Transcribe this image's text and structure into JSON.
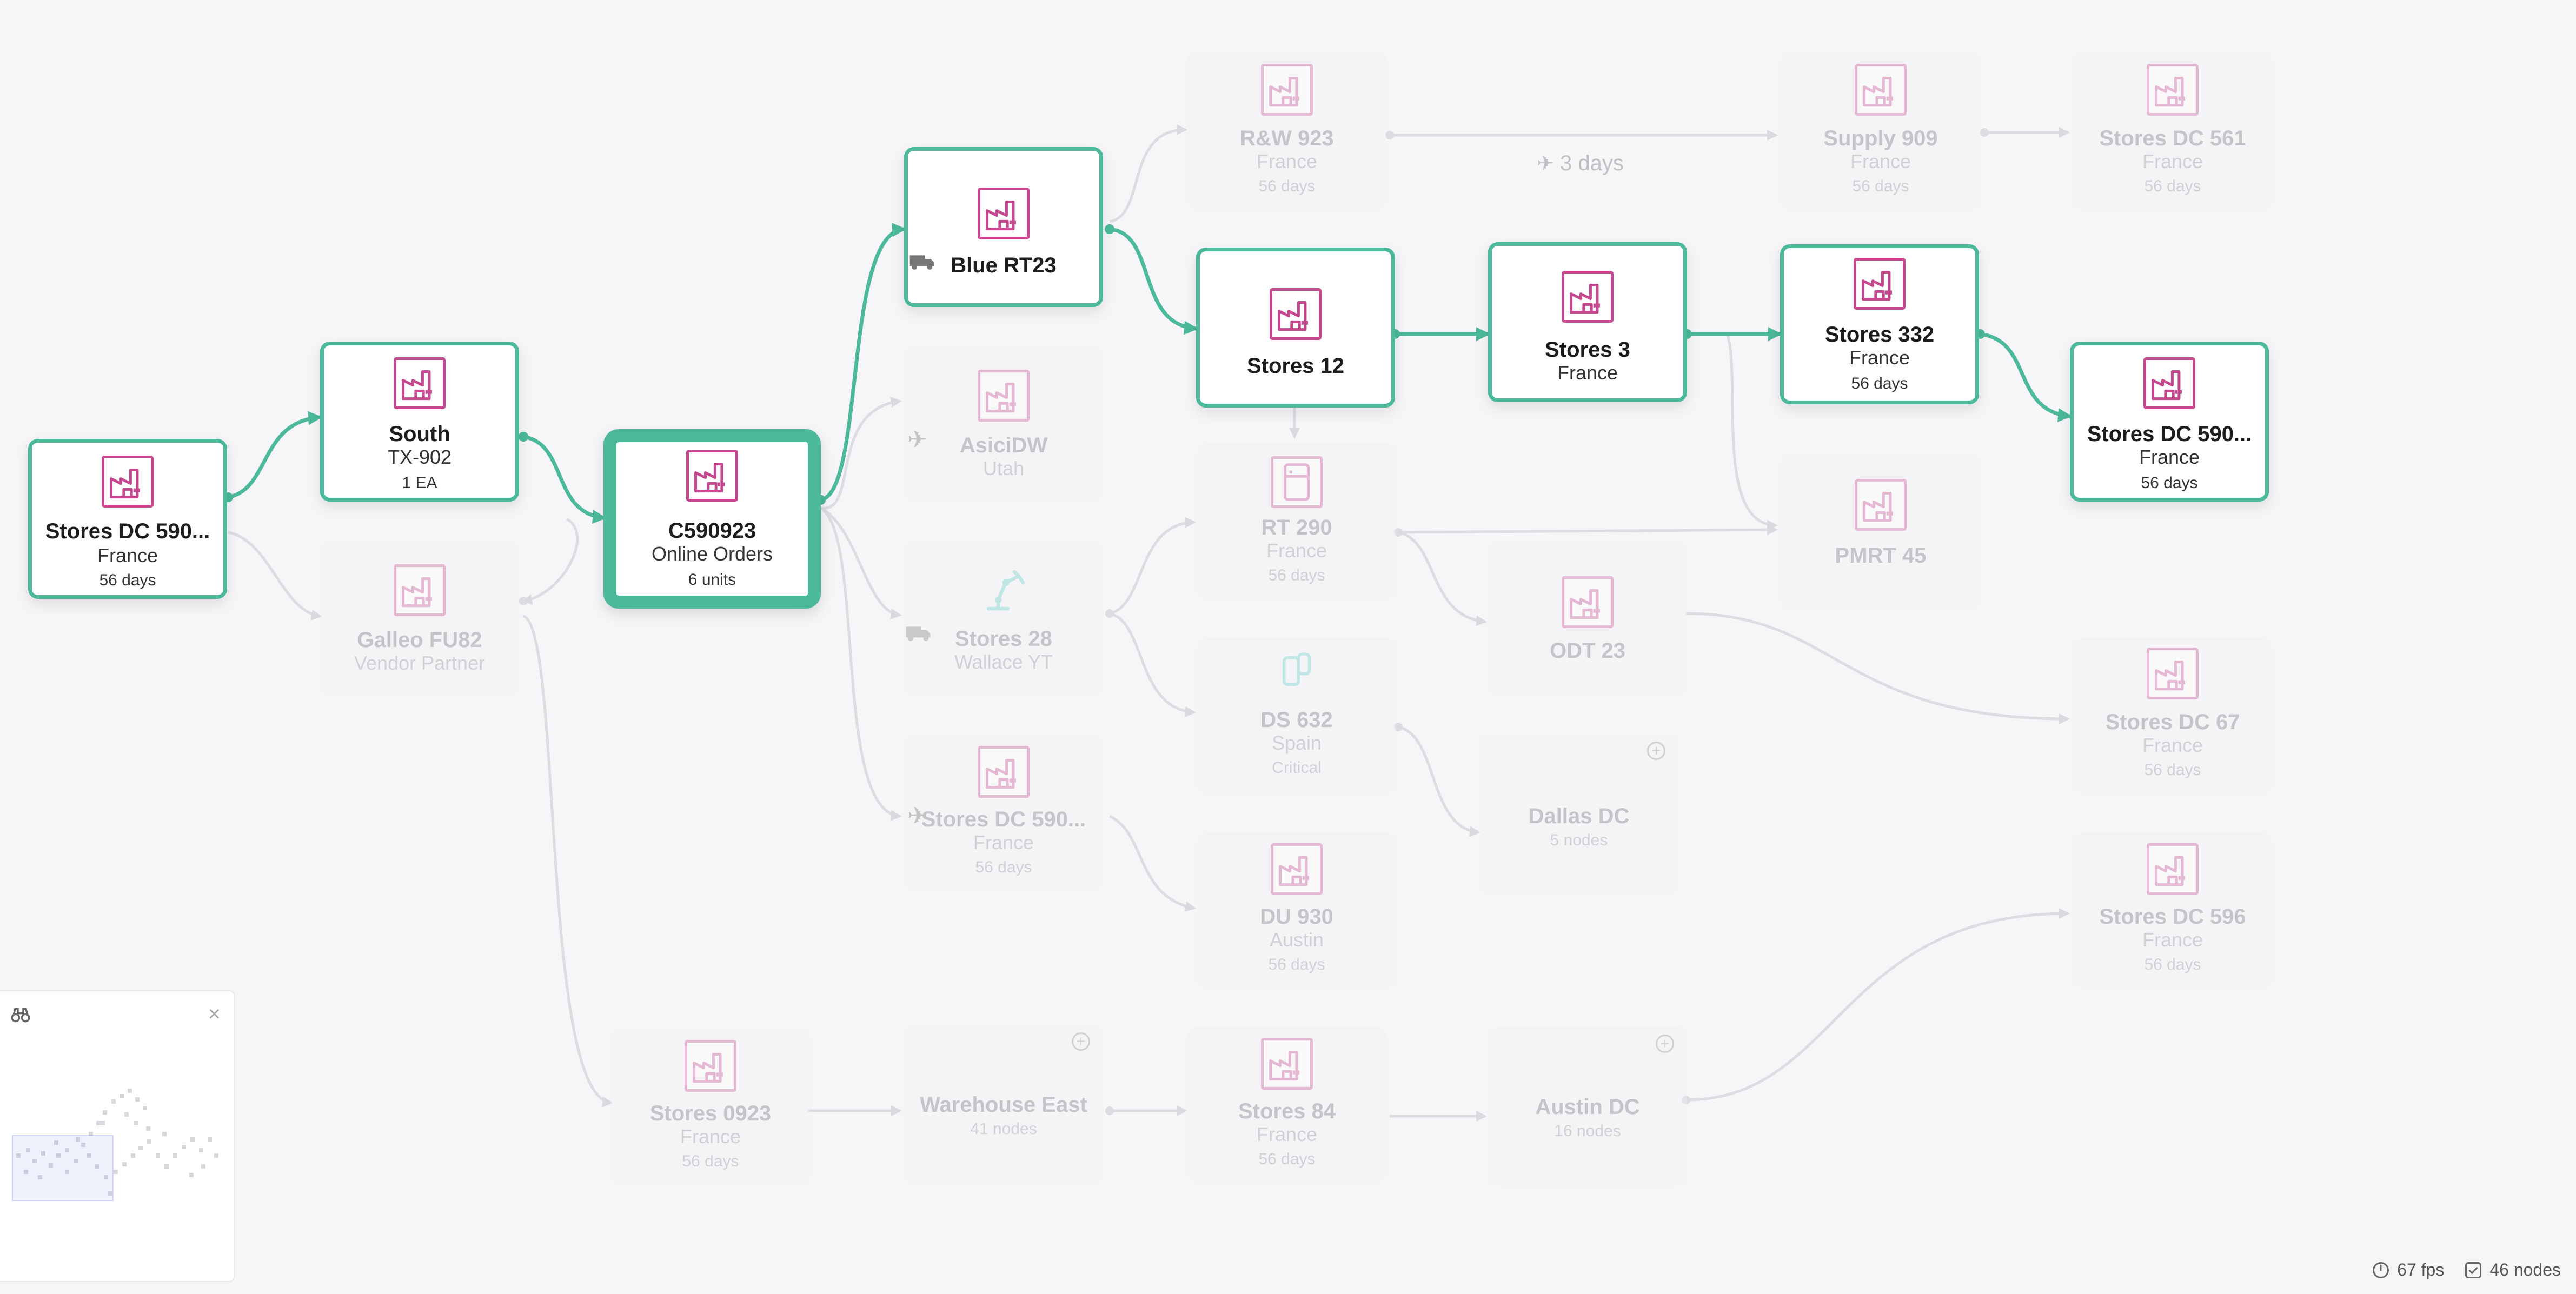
{
  "colors": {
    "accent": "#4cb99a",
    "icon": "#c5478e",
    "edge_faded": "#d9d9de",
    "teal_icon": "#5ac6c0"
  },
  "nodes": {
    "stores_dc_590_a": {
      "title": "Stores DC 590...",
      "subtitle": "France",
      "detail": "56 days",
      "icon": "factory-icon"
    },
    "south": {
      "title": "South",
      "subtitle": "TX-902",
      "detail": "1 EA",
      "icon": "factory-icon"
    },
    "galleo": {
      "title": "Galleo FU82",
      "subtitle": "Vendor Partner",
      "icon": "factory-icon"
    },
    "c590923": {
      "title": "C590923",
      "subtitle": "Online Orders",
      "detail": "6 units",
      "icon": "factory-icon"
    },
    "blue_rt23": {
      "title": "Blue RT23",
      "icon": "factory-icon",
      "side_icon": "truck-icon"
    },
    "asicidw": {
      "title": "AsiciDW",
      "subtitle": "Utah",
      "icon": "factory-icon",
      "side_icon": "plane-icon"
    },
    "stores_28": {
      "title": "Stores 28",
      "subtitle": "Wallace YT",
      "icon": "robot-arm-icon",
      "side_icon": "truck-icon"
    },
    "stores_dc_590_b": {
      "title": "Stores DC 590...",
      "subtitle": "France",
      "detail": "56 days",
      "icon": "factory-icon",
      "side_icon": "plane-icon"
    },
    "rw_923": {
      "title": "R&W 923",
      "subtitle": "France",
      "detail": "56 days",
      "icon": "factory-icon"
    },
    "stores_12": {
      "title": "Stores 12",
      "icon": "factory-icon"
    },
    "rt_290": {
      "title": "RT 290",
      "subtitle": "France",
      "detail": "56 days",
      "icon": "fridge-icon"
    },
    "ds_632": {
      "title": "DS 632",
      "subtitle": "Spain",
      "detail": "Critical",
      "icon": "tank-icon"
    },
    "du_930": {
      "title": "DU 930",
      "subtitle": "Austin",
      "detail": "56 days",
      "icon": "factory-icon"
    },
    "stores_3": {
      "title": "Stores 3",
      "subtitle": "France",
      "icon": "factory-icon"
    },
    "odt_23": {
      "title": "ODT 23",
      "icon": "factory-icon"
    },
    "dallas_dc": {
      "title": "Dallas DC",
      "subtitle": "5 nodes",
      "icon": "plus-icon"
    },
    "supply_909": {
      "title": "Supply 909",
      "subtitle": "France",
      "detail": "56 days",
      "icon": "factory-icon"
    },
    "stores_332": {
      "title": "Stores 332",
      "subtitle": "France",
      "detail": "56 days",
      "icon": "factory-icon"
    },
    "pmrt_45": {
      "title": "PMRT 45",
      "icon": "factory-icon"
    },
    "stores_dc_561": {
      "title": "Stores DC 561",
      "subtitle": "France",
      "detail": "56 days",
      "icon": "factory-icon"
    },
    "stores_dc_590_c": {
      "title": "Stores DC 590...",
      "subtitle": "France",
      "detail": "56 days",
      "icon": "factory-icon"
    },
    "stores_dc_67": {
      "title": "Stores DC 67",
      "subtitle": "France",
      "detail": "56 days",
      "icon": "factory-icon"
    },
    "stores_dc_596": {
      "title": "Stores DC 596",
      "subtitle": "France",
      "detail": "56 days",
      "icon": "factory-icon"
    },
    "stores_0923": {
      "title": "Stores 0923",
      "subtitle": "France",
      "detail": "56 days",
      "icon": "factory-icon"
    },
    "warehouse_east": {
      "title": "Warehouse East",
      "subtitle": "41 nodes",
      "icon": "plus-icon"
    },
    "stores_84": {
      "title": "Stores 84",
      "subtitle": "France",
      "detail": "56 days",
      "icon": "factory-icon"
    },
    "austin_dc": {
      "title": "Austin DC",
      "subtitle": "16 nodes",
      "icon": "plus-icon"
    }
  },
  "edge_label": {
    "text": "3 days",
    "icon": "plane-icon"
  },
  "minimap": {
    "icon": "binoculars-icon",
    "close": "×"
  },
  "status": {
    "fps": "67 fps",
    "nodes": "46 nodes",
    "fps_icon": "gauge-icon",
    "nodes_icon": "checkbox-icon"
  }
}
